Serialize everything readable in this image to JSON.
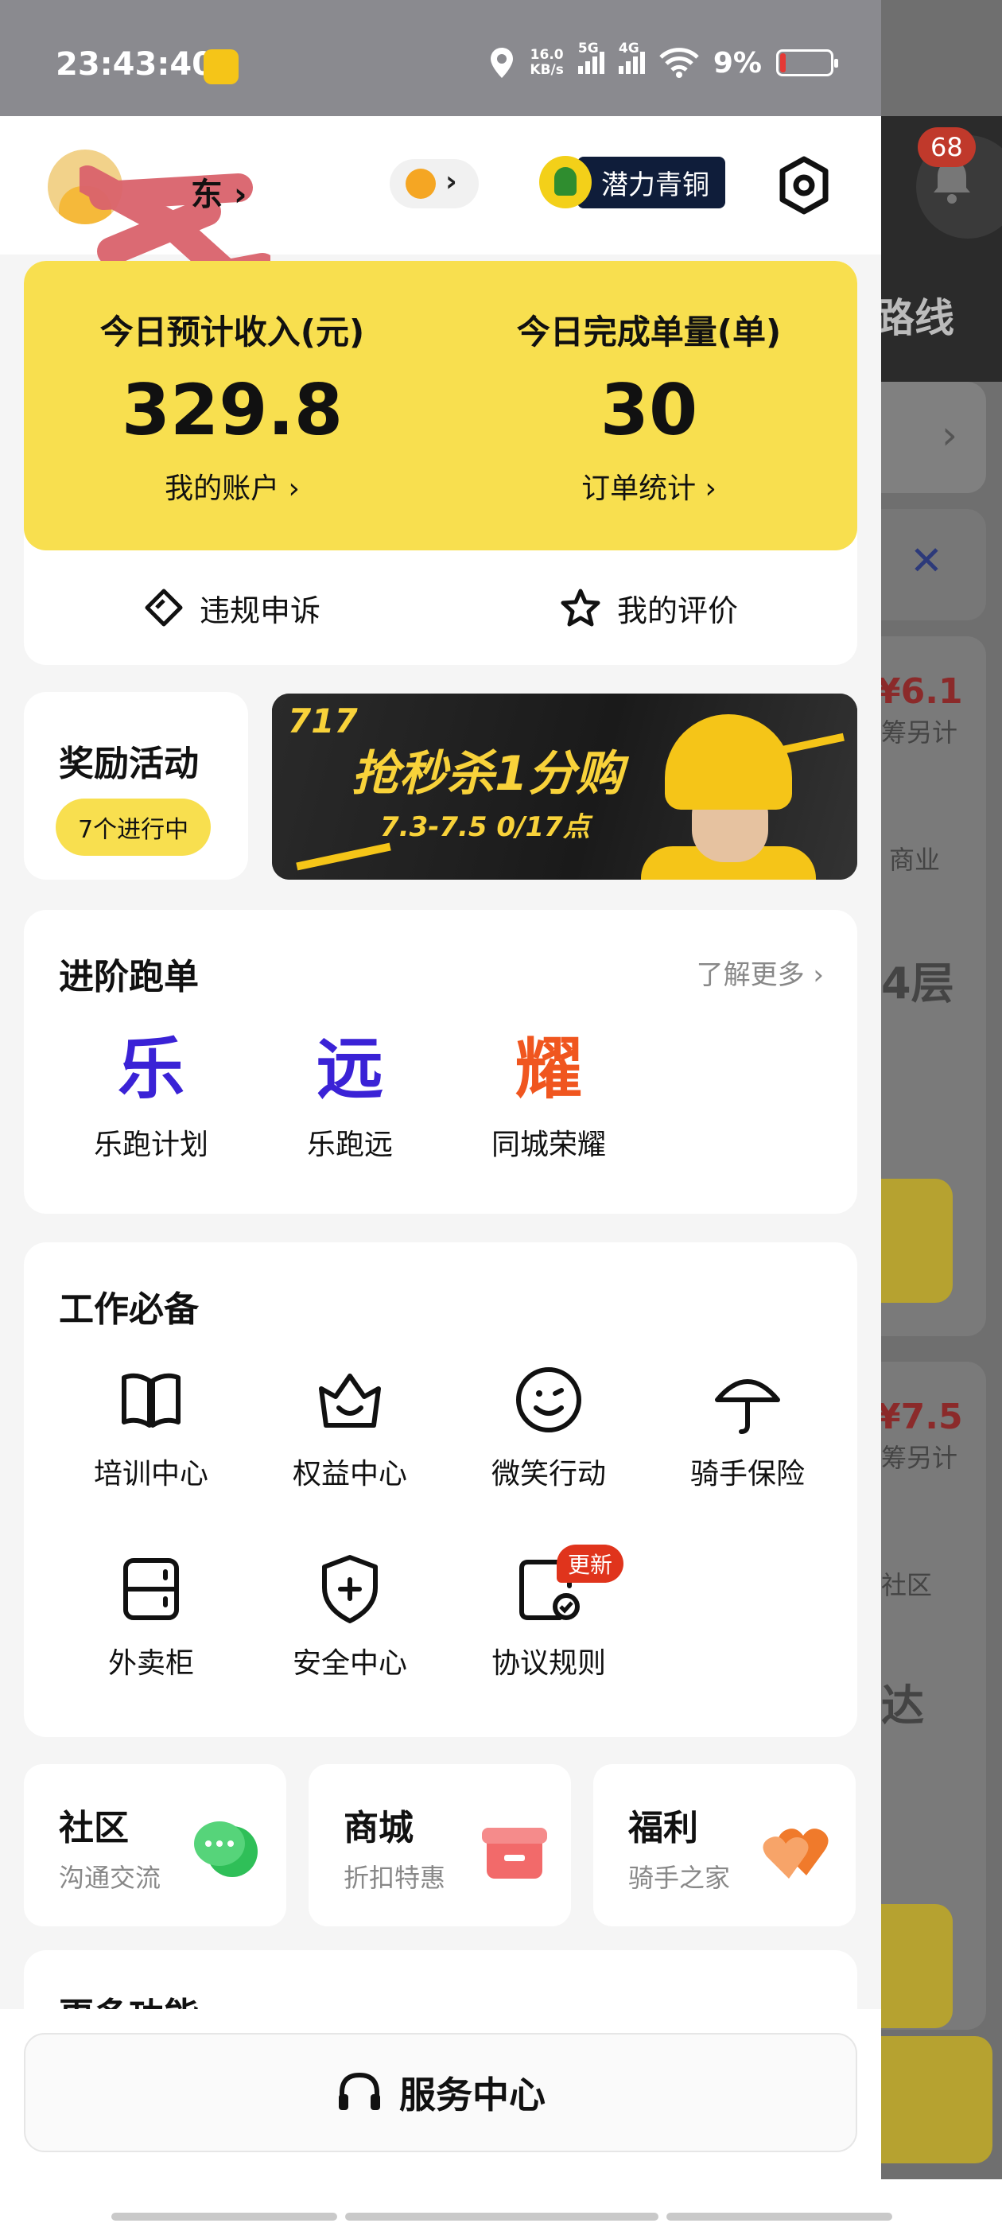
{
  "status_bar": {
    "time": "23:43:40",
    "net_speed_value": "16.0",
    "net_speed_unit": "KB/s",
    "signal_1": "5G",
    "signal_2": "4G",
    "battery": "9%"
  },
  "header": {
    "user_name": "东",
    "tier_label": "潜力青铜"
  },
  "income": {
    "revenue_title": "今日预计收入(元)",
    "revenue_value": "329.8",
    "account_link": "我的账户",
    "orders_title": "今日完成单量(单)",
    "orders_value": "30",
    "orders_link": "订单统计",
    "appeal_label": "违规申诉",
    "rating_label": "我的评价"
  },
  "rewards": {
    "title": "奖励活动",
    "ongoing": "7个进行中"
  },
  "banner": {
    "tag": "717",
    "headline": "抢秒杀1分购",
    "dates": "7.3-7.5 0/17点"
  },
  "advanced": {
    "title": "进阶跑单",
    "more": "了解更多",
    "items": [
      {
        "glyph": "乐",
        "label": "乐跑计划",
        "color": "#3a22d6"
      },
      {
        "glyph": "远",
        "label": "乐跑远",
        "color": "#3a22d6"
      },
      {
        "glyph": "耀",
        "label": "同城荣耀",
        "color": "#f0561f"
      }
    ]
  },
  "work": {
    "title": "工作必备",
    "items": [
      {
        "icon": "book-icon",
        "label": "培训中心"
      },
      {
        "icon": "crown-icon",
        "label": "权益中心"
      },
      {
        "icon": "smile-icon",
        "label": "微笑行动"
      },
      {
        "icon": "umbrella-icon",
        "label": "骑手保险"
      },
      {
        "icon": "locker-icon",
        "label": "外卖柜"
      },
      {
        "icon": "shield-plus-icon",
        "label": "安全中心"
      },
      {
        "icon": "document-check-icon",
        "label": "协议规则"
      }
    ],
    "new_badge": "更新"
  },
  "mini_cards": [
    {
      "title": "社区",
      "subtitle": "沟通交流",
      "icon": "chat-bubbles-icon"
    },
    {
      "title": "商城",
      "subtitle": "折扣特惠",
      "icon": "gift-box-icon"
    },
    {
      "title": "福利",
      "subtitle": "骑手之家",
      "icon": "hearts-icon"
    }
  ],
  "more_features": {
    "title": "更多功能"
  },
  "service": {
    "label": "服务中心"
  },
  "background_app": {
    "notification_count": "68",
    "route_text": "路线",
    "price_1": "¥6.1",
    "price_1_note": "筹另计",
    "area_1": "商业",
    "floor_text": "4层",
    "price_2": "¥7.5",
    "price_2_note": "筹另计",
    "area_2": "社区",
    "arrive_text": "达"
  },
  "colors": {
    "brand_yellow": "#f8df4f",
    "accent_blue": "#3a22d6",
    "accent_orange": "#f0561f",
    "badge_red": "#e0341c"
  }
}
